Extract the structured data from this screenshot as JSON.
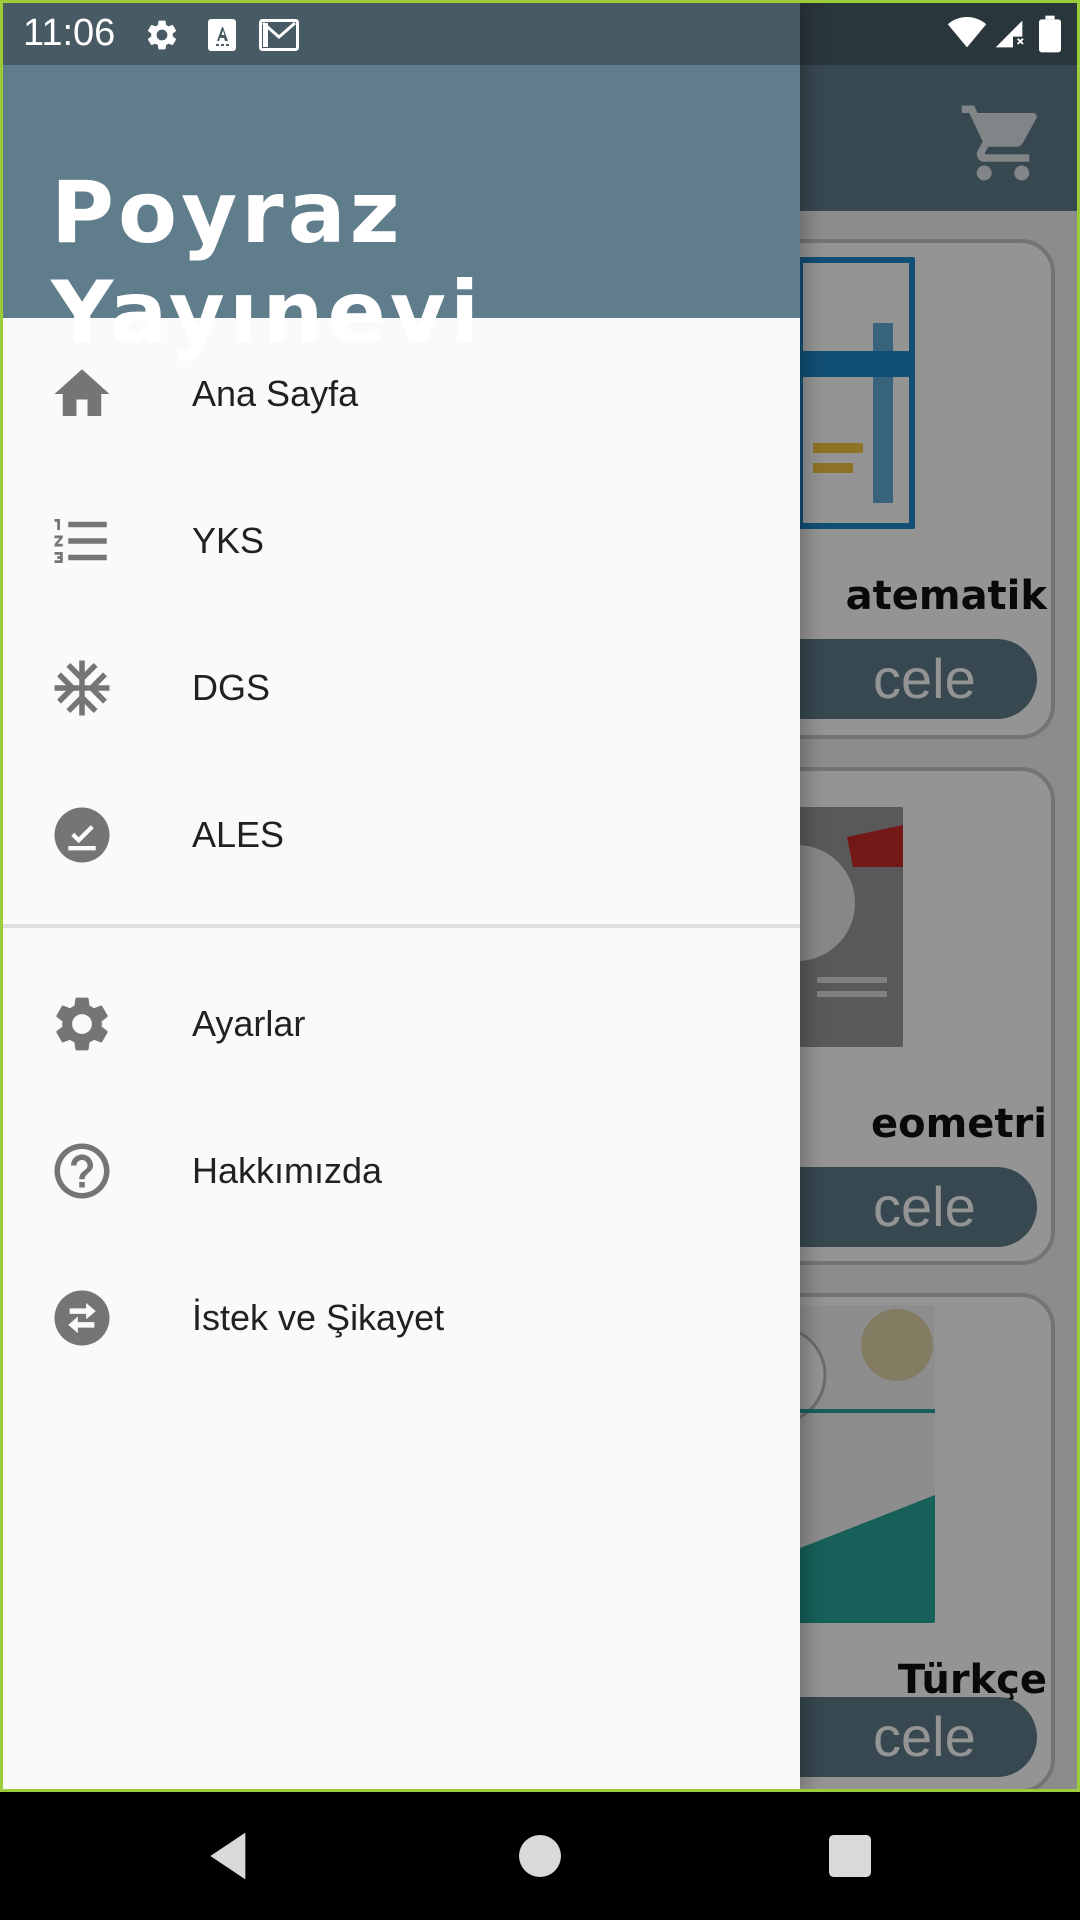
{
  "status_bar": {
    "time": "11:06",
    "left_icons": [
      "gear-icon",
      "text-a-icon",
      "mail-icon"
    ],
    "right_icons": [
      "wifi-icon",
      "signal-icon",
      "battery-icon"
    ]
  },
  "background_app": {
    "cart_icon": "shopping-cart-icon",
    "cards": [
      {
        "title": "atematik",
        "button_label": "cele"
      },
      {
        "title": "eometri",
        "button_label": "cele"
      },
      {
        "title": "Türkçe",
        "button_label": "cele"
      }
    ]
  },
  "drawer": {
    "header_title": "Poyraz Yayınevi",
    "primary_items": [
      {
        "label": "Ana Sayfa",
        "icon": "home-icon"
      },
      {
        "label": "YKS",
        "icon": "numbered-list-icon"
      },
      {
        "label": "DGS",
        "icon": "asterisk-icon"
      },
      {
        "label": "ALES",
        "icon": "check-circle-icon"
      }
    ],
    "secondary_items": [
      {
        "label": "Ayarlar",
        "icon": "settings-icon"
      },
      {
        "label": "Hakkımızda",
        "icon": "help-circle-icon"
      },
      {
        "label": "İstek ve Şikayet",
        "icon": "swap-circle-icon"
      }
    ]
  },
  "nav_bar": {
    "buttons": [
      "back",
      "home",
      "recents"
    ]
  },
  "colors": {
    "primary": "#607d8b",
    "drawer_bg": "#fafafa",
    "icon_gray": "#757575",
    "text": "#212121"
  }
}
